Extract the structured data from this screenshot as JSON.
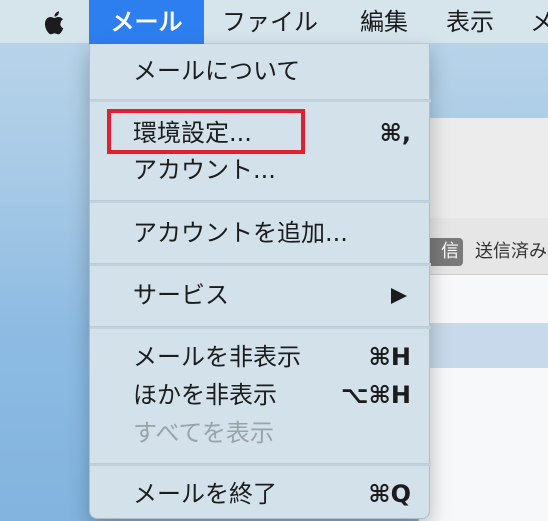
{
  "menubar": {
    "apple_icon": "apple-icon",
    "items": [
      "メール",
      "ファイル",
      "編集",
      "表示",
      "メ"
    ]
  },
  "menu": {
    "about": "メールについて",
    "preferences": {
      "label": "環境設定...",
      "shortcut": "⌘,"
    },
    "accounts": "アカウント...",
    "add_account": "アカウントを追加...",
    "services": "サービス",
    "hide_mail": {
      "label": "メールを非表示",
      "shortcut": "⌘H"
    },
    "hide_others": {
      "label": "ほかを非表示",
      "shortcut": "⌥⌘H"
    },
    "show_all": "すべてを表示",
    "quit": {
      "label": "メールを終了",
      "shortcut": "⌘Q"
    }
  },
  "window": {
    "active_segment": "信",
    "sent_segment": "送信済み"
  },
  "colors": {
    "menubar_bg": "#d6e4ec",
    "menubar_selected": "#2d7ff0",
    "menu_bg": "#d2e1ea",
    "highlight": "#e0202a"
  }
}
